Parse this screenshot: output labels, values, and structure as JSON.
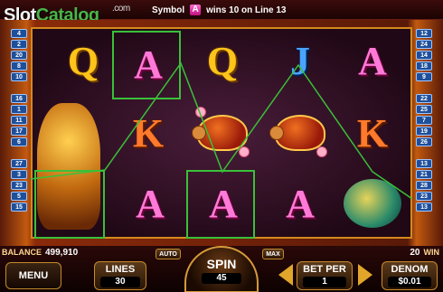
{
  "logo": {
    "slot": "Slot",
    "catalog": "Catalog",
    "dotcom": ".com"
  },
  "win_message": {
    "prefix": "Symbol",
    "symbol": "A",
    "suffix": "wins 10 on Line 13"
  },
  "paylines_left": [
    "4",
    "2",
    "20",
    "8",
    "10",
    "16",
    "1",
    "11",
    "17",
    "6",
    "27",
    "3",
    "23",
    "5",
    "15"
  ],
  "paylines_right": [
    "12",
    "24",
    "14",
    "18",
    "9",
    "22",
    "25",
    "7",
    "19",
    "26",
    "13",
    "21",
    "28",
    "23",
    "13"
  ],
  "reels": [
    [
      "Q",
      "dragon",
      "dragon"
    ],
    [
      "A",
      "K",
      "A"
    ],
    [
      "Q",
      "turtle",
      "A"
    ],
    [
      "J",
      "turtle",
      "A"
    ],
    [
      "A",
      "K",
      "fish"
    ]
  ],
  "balance": {
    "label": "BALANCE",
    "value": "499,910"
  },
  "win": {
    "count": "20",
    "label": "WIN"
  },
  "buttons": {
    "menu": "MENU",
    "auto": "AUTO",
    "max": "MAX",
    "lines_label": "LINES",
    "lines_value": "30",
    "spin_label": "SPIN",
    "spin_value": "45",
    "betper_label": "BET PER",
    "betper_value": "1",
    "denom_label": "DENOM",
    "denom_value": "$0.01"
  },
  "colors": {
    "highlight": "#3ac03a",
    "frame": "#d48a1c"
  }
}
